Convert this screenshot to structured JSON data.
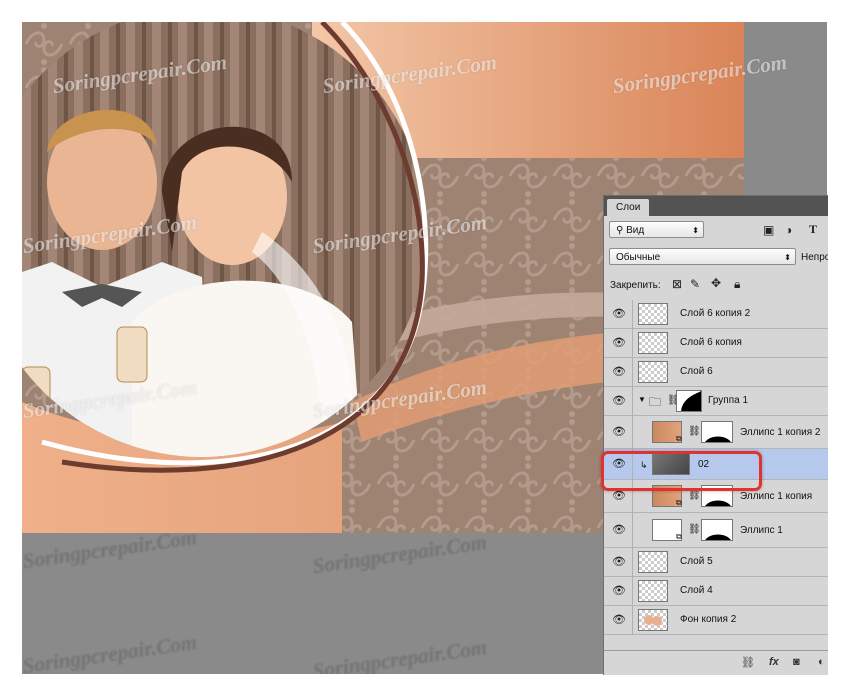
{
  "watermark": "Soringpcrepair.Com",
  "panel": {
    "tab_label": "Слои",
    "filter": {
      "label": "Вид"
    },
    "blend_mode": {
      "label": "Обычные"
    },
    "opacity_label": "Непро",
    "lock_label": "Закрепить:",
    "layers": [
      {
        "name": "Слой 6 копия 2"
      },
      {
        "name": "Слой 6 копия"
      },
      {
        "name": "Слой 6"
      },
      {
        "name": "Группа 1"
      },
      {
        "name": "Эллипс 1 копия 2"
      },
      {
        "name": "02"
      },
      {
        "name": "Эллипс 1 копия"
      },
      {
        "name": "Эллипс 1"
      },
      {
        "name": "Слой 5"
      },
      {
        "name": "Слой 4"
      },
      {
        "name": "Фон копия 2"
      }
    ],
    "bottom": {
      "fx_label": "fx"
    }
  },
  "colors": {
    "accent_selection": "#b6c8ec",
    "highlight": "#e23131"
  }
}
